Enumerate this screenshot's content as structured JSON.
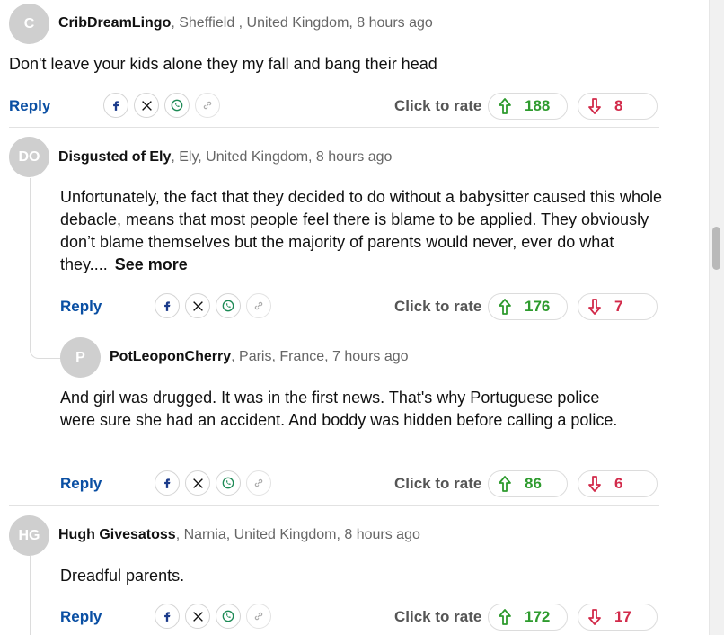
{
  "ui": {
    "reply_label": "Reply",
    "rate_label": "Click to rate",
    "see_more_label": "See more",
    "colors": {
      "reply": "#0a4fa3",
      "upvote": "#2e9b2e",
      "downvote": "#d22a4a",
      "avatar_bg": "#cfcfcf"
    },
    "share_icons": [
      "facebook-icon",
      "x-icon",
      "whatsapp-icon",
      "link-icon"
    ]
  },
  "comments": [
    {
      "initials": "C",
      "author": "CribDreamLingo",
      "location_time": ", Sheffield , United Kingdom, 8 hours ago",
      "text": "Don't leave your kids alone they my fall and bang their head",
      "upvotes": "188",
      "downvotes": "8"
    },
    {
      "initials": "DO",
      "author": "Disgusted of Ely",
      "location_time": ", Ely, United Kingdom, 8 hours ago",
      "text": "Unfortunately, the fact that they decided to do without a babysitter caused this whole debacle, means that most people feel there is blame to be applied. They obviously don’t blame themselves but the majority of parents would never, ever do what they....",
      "upvotes": "176",
      "downvotes": "7"
    },
    {
      "initials": "P",
      "author": "PotLeoponCherry",
      "location_time": ", Paris, France, 7 hours ago",
      "text": "And girl was drugged. It was in the first news. That's why Portuguese police were sure she had an accident. And boddy was hidden before calling a police.",
      "upvotes": "86",
      "downvotes": "6"
    },
    {
      "initials": "HG",
      "author": "Hugh Givesatoss",
      "location_time": ", Narnia, United Kingdom, 8 hours ago",
      "text": "Dreadful parents.",
      "upvotes": "172",
      "downvotes": "17"
    }
  ]
}
